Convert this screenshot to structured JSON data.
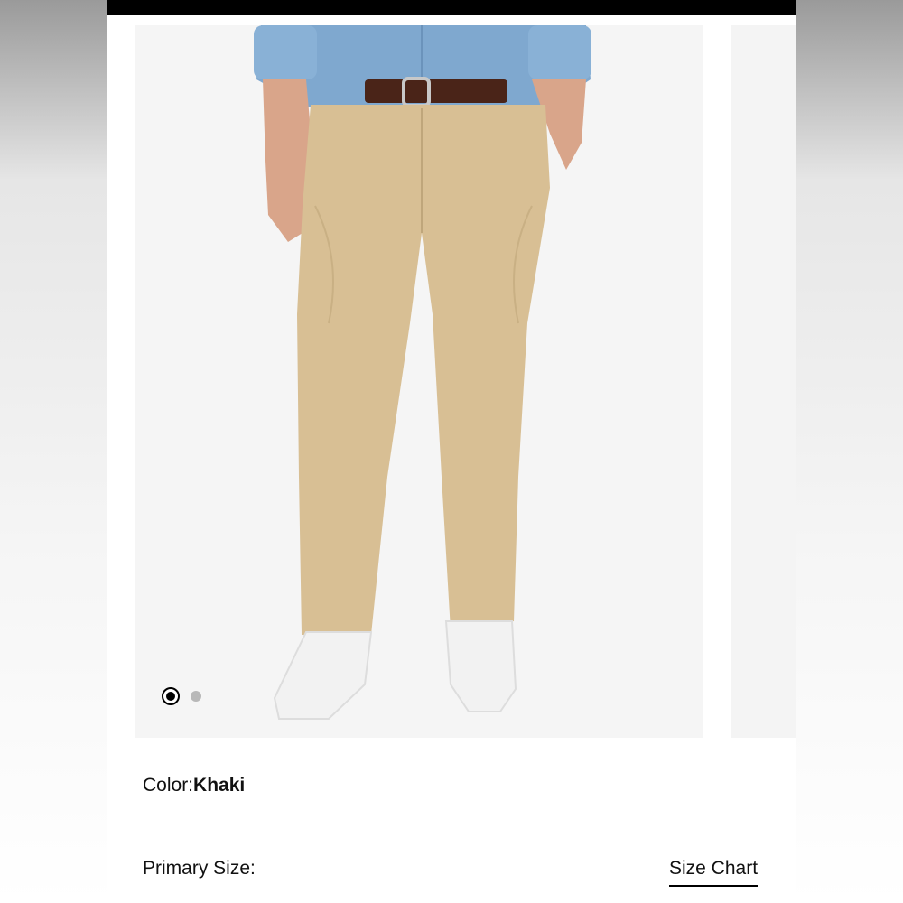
{
  "product": {
    "color_label": "Color:",
    "color_value": "Khaki",
    "image_alt": "Khaki pants product photo"
  },
  "carousel": {
    "slide_count": 2,
    "active_index": 0,
    "dots": [
      "active",
      "inactive"
    ]
  },
  "size": {
    "label": "Primary Size:",
    "size_chart_link": "Size Chart"
  },
  "colors": {
    "pants": "#d8bf94",
    "shirt": "#7fa8cf",
    "belt": "#4a2418",
    "shoes": "#f2f2f2"
  }
}
